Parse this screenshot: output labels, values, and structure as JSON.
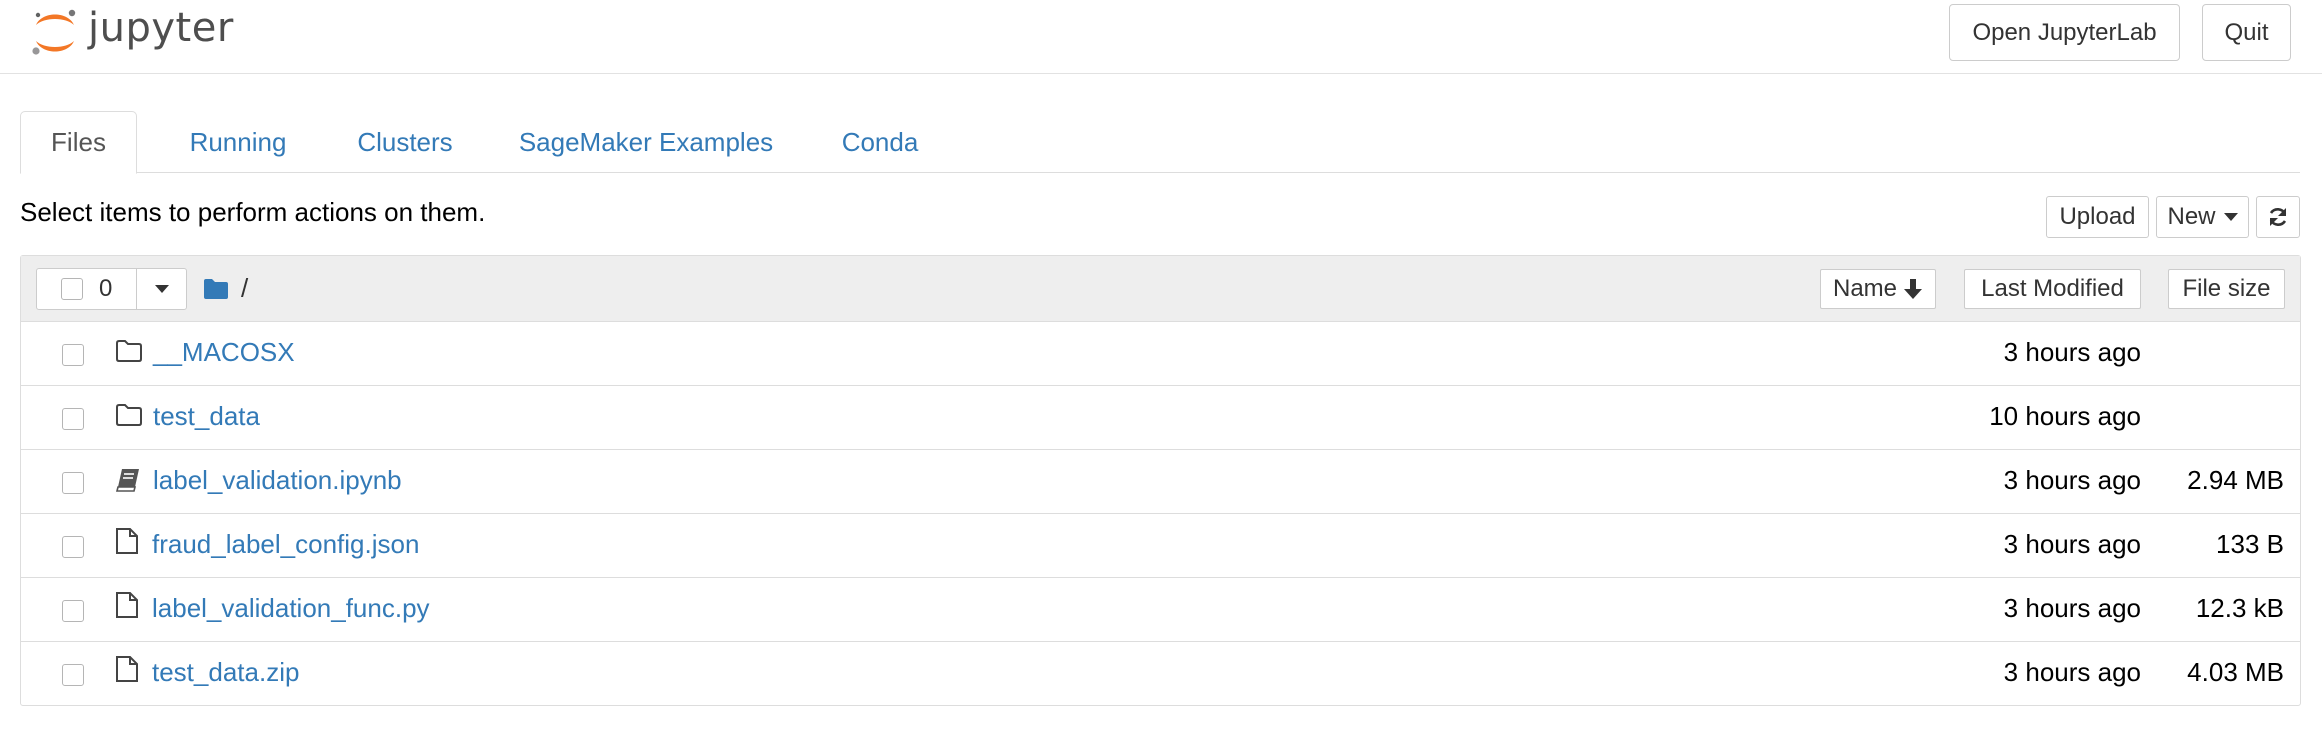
{
  "header": {
    "logo_text": "jupyter",
    "open_jupyterlab_label": "Open JupyterLab",
    "quit_label": "Quit"
  },
  "tabs": [
    {
      "label": "Files",
      "active": true
    },
    {
      "label": "Running",
      "active": false
    },
    {
      "label": "Clusters",
      "active": false
    },
    {
      "label": "SageMaker Examples",
      "active": false
    },
    {
      "label": "Conda",
      "active": false
    }
  ],
  "toolbar": {
    "instructions": "Select items to perform actions on them.",
    "upload_label": "Upload",
    "new_label": "New",
    "refresh_icon": "refresh-icon"
  },
  "list": {
    "selected_count": "0",
    "breadcrumb_path": "/",
    "columns": {
      "name": "Name",
      "last_modified": "Last Modified",
      "file_size": "File size"
    },
    "items": [
      {
        "type": "folder",
        "icon": "folder-outline-icon",
        "name": "__MACOSX",
        "modified": "3 hours ago",
        "size": ""
      },
      {
        "type": "folder",
        "icon": "folder-outline-icon",
        "name": "test_data",
        "modified": "10 hours ago",
        "size": ""
      },
      {
        "type": "notebook",
        "icon": "notebook-icon",
        "name": "label_validation.ipynb",
        "modified": "3 hours ago",
        "size": "2.94 MB"
      },
      {
        "type": "file",
        "icon": "file-icon",
        "name": "fraud_label_config.json",
        "modified": "3 hours ago",
        "size": "133 B"
      },
      {
        "type": "file",
        "icon": "file-icon",
        "name": "label_validation_func.py",
        "modified": "3 hours ago",
        "size": "12.3 kB"
      },
      {
        "type": "file",
        "icon": "file-icon",
        "name": "test_data.zip",
        "modified": "3 hours ago",
        "size": "4.03 MB"
      }
    ]
  },
  "colors": {
    "link": "#337ab7",
    "logo_orange": "#f37726",
    "header_gray": "#eeeeee",
    "border": "#dddddd"
  }
}
